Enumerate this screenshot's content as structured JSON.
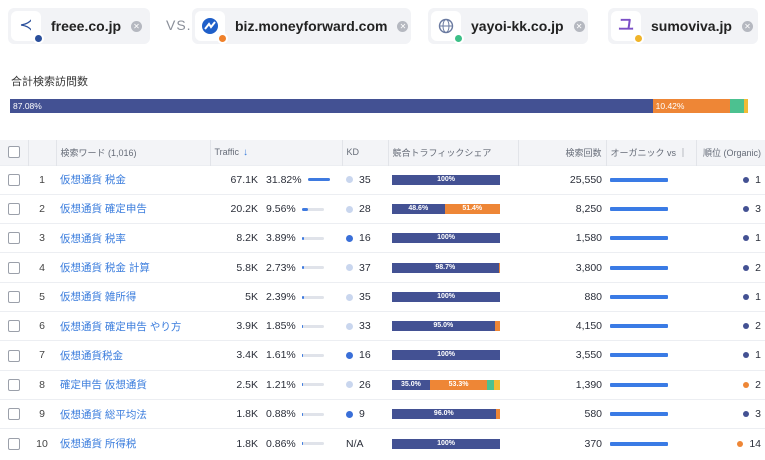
{
  "colors": {
    "freee": "#2a4f9b",
    "biz": "#f0812a",
    "yayoi": "#3cbf87",
    "sumoviva": "#f0b429",
    "navy": "#435193",
    "orange": "#ee8636",
    "green": "#4cc190",
    "yellow": "#f2bb35",
    "link": "#3b7ddd"
  },
  "competitors": [
    {
      "domain": "freee.co.jp",
      "icon": "freee-bird-icon",
      "dot": "#2a4f9b",
      "remove": "✕"
    },
    {
      "domain": "biz.moneyforward.com",
      "icon": "moneyforward-icon",
      "dot": "#f0812a",
      "remove": "✕"
    },
    {
      "domain": "yayoi-kk.co.jp",
      "icon": "yayoi-globe-icon",
      "dot": "#3cbf87",
      "remove": "✕"
    },
    {
      "domain": "sumoviva.jp",
      "icon": "sumoviva-icon",
      "dot": "#f0b429",
      "remove": "✕"
    }
  ],
  "vs_label": "VS.",
  "total": {
    "title": "合計検索訪問数",
    "segments": [
      {
        "label": "87.08%",
        "value": 87.08,
        "color": "#435193"
      },
      {
        "label": "10.42%",
        "value": 10.42,
        "color": "#ee8636"
      },
      {
        "label": "",
        "value": 1.9,
        "color": "#4cc190"
      },
      {
        "label": "",
        "value": 0.6,
        "color": "#f2bb35"
      }
    ]
  },
  "table": {
    "headers": {
      "keyword": "検索ワード (1,016)",
      "traffic": "Traffic",
      "traffic_sort_icon": "↓",
      "kd": "KD",
      "share": "競合トラフィックシェア",
      "volume": "検索回数",
      "organic": "オーガニック vs ｜",
      "position": "順位 (Organic)"
    },
    "rows": [
      {
        "n": "1",
        "keyword": "仮想通貨 税金",
        "traffic": "67.1K",
        "pct": "31.82%",
        "spark": 100,
        "kd_color": "#c9d6ee",
        "kd": "35",
        "share": [
          {
            "v": 100,
            "c": "#435193",
            "l": "100%"
          }
        ],
        "volume": "25,550",
        "organic": 100,
        "pos_color": "#435193",
        "pos": "1"
      },
      {
        "n": "2",
        "keyword": "仮想通貨 確定申告",
        "traffic": "20.2K",
        "pct": "9.56%",
        "spark": 30,
        "kd_color": "#c9d6ee",
        "kd": "28",
        "share": [
          {
            "v": 48.6,
            "c": "#435193",
            "l": "48.6%"
          },
          {
            "v": 51.4,
            "c": "#ee8636",
            "l": "51.4%"
          }
        ],
        "volume": "8,250",
        "organic": 100,
        "pos_color": "#435193",
        "pos": "3"
      },
      {
        "n": "3",
        "keyword": "仮想通貨 税率",
        "traffic": "8.2K",
        "pct": "3.89%",
        "spark": 12,
        "kd_color": "#3a6fd8",
        "kd": "16",
        "share": [
          {
            "v": 100,
            "c": "#435193",
            "l": "100%"
          }
        ],
        "volume": "1,580",
        "organic": 100,
        "pos_color": "#435193",
        "pos": "1"
      },
      {
        "n": "4",
        "keyword": "仮想通貨 税金 計算",
        "traffic": "5.8K",
        "pct": "2.73%",
        "spark": 9,
        "kd_color": "#c9d6ee",
        "kd": "37",
        "share": [
          {
            "v": 98.7,
            "c": "#435193",
            "l": "98.7%"
          },
          {
            "v": 1.3,
            "c": "#ee8636",
            "l": ""
          }
        ],
        "volume": "3,800",
        "organic": 100,
        "pos_color": "#435193",
        "pos": "2"
      },
      {
        "n": "5",
        "keyword": "仮想通貨 雑所得",
        "traffic": "5K",
        "pct": "2.39%",
        "spark": 8,
        "kd_color": "#c9d6ee",
        "kd": "35",
        "share": [
          {
            "v": 100,
            "c": "#435193",
            "l": "100%"
          }
        ],
        "volume": "880",
        "organic": 100,
        "pos_color": "#435193",
        "pos": "1"
      },
      {
        "n": "6",
        "keyword": "仮想通貨 確定申告 やり方",
        "traffic": "3.9K",
        "pct": "1.85%",
        "spark": 6,
        "kd_color": "#c9d6ee",
        "kd": "33",
        "share": [
          {
            "v": 95.0,
            "c": "#435193",
            "l": "95.0%"
          },
          {
            "v": 5.0,
            "c": "#ee8636",
            "l": ""
          }
        ],
        "volume": "4,150",
        "organic": 100,
        "pos_color": "#435193",
        "pos": "2"
      },
      {
        "n": "7",
        "keyword": "仮想通貨税金",
        "traffic": "3.4K",
        "pct": "1.61%",
        "spark": 5,
        "kd_color": "#3a6fd8",
        "kd": "16",
        "share": [
          {
            "v": 100,
            "c": "#435193",
            "l": "100%"
          }
        ],
        "volume": "3,550",
        "organic": 100,
        "pos_color": "#435193",
        "pos": "1"
      },
      {
        "n": "8",
        "keyword": "確定申告 仮想通貨",
        "traffic": "2.5K",
        "pct": "1.21%",
        "spark": 4,
        "kd_color": "#c9d6ee",
        "kd": "26",
        "share": [
          {
            "v": 35.0,
            "c": "#435193",
            "l": "35.0%"
          },
          {
            "v": 53.3,
            "c": "#ee8636",
            "l": "53.3%"
          },
          {
            "v": 6.5,
            "c": "#4cc190",
            "l": ""
          },
          {
            "v": 5.2,
            "c": "#f2bb35",
            "l": ""
          }
        ],
        "volume": "1,390",
        "organic": 100,
        "pos_color": "#ee8636",
        "pos": "2"
      },
      {
        "n": "9",
        "keyword": "仮想通貨 総平均法",
        "traffic": "1.8K",
        "pct": "0.88%",
        "spark": 3,
        "kd_color": "#3a6fd8",
        "kd": "9",
        "share": [
          {
            "v": 96.0,
            "c": "#435193",
            "l": "96.0%"
          },
          {
            "v": 4.0,
            "c": "#ee8636",
            "l": ""
          }
        ],
        "volume": "580",
        "organic": 100,
        "pos_color": "#435193",
        "pos": "3"
      },
      {
        "n": "10",
        "keyword": "仮想通貨 所得税",
        "traffic": "1.8K",
        "pct": "0.86%",
        "spark": 3,
        "kd_color": "",
        "kd": "N/A",
        "share": [
          {
            "v": 100,
            "c": "#435193",
            "l": "100%"
          }
        ],
        "volume": "370",
        "organic": 100,
        "pos_color": "#ee8636",
        "pos": "14"
      }
    ]
  }
}
